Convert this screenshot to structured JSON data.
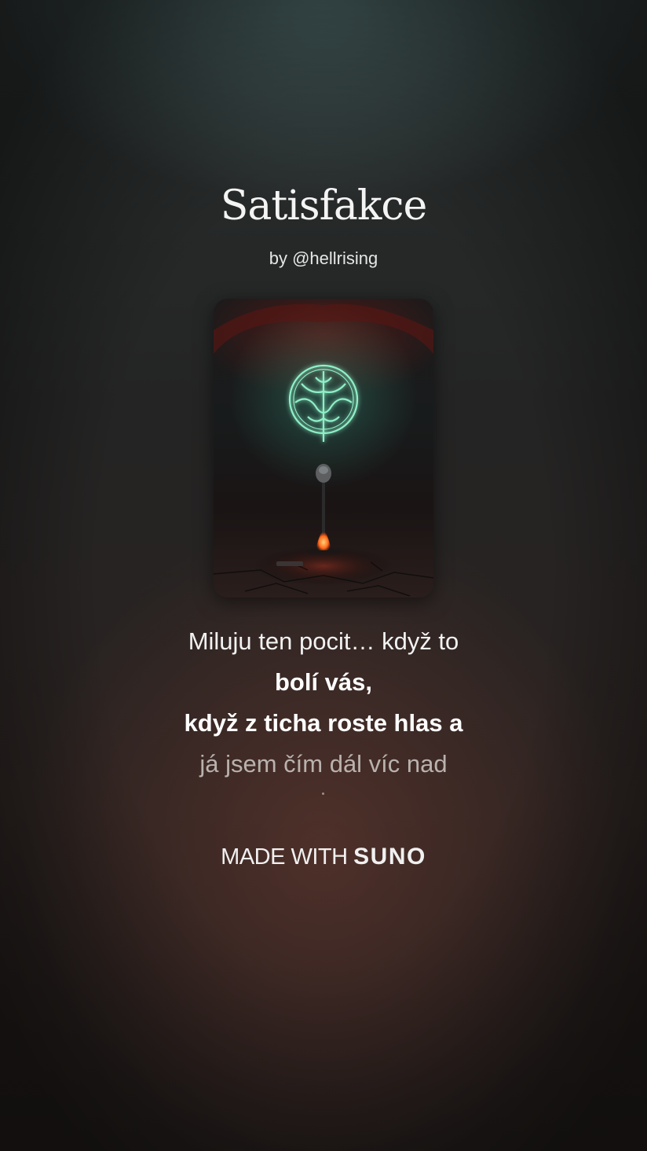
{
  "song": {
    "title": "Satisfakce",
    "byline": "by @hellrising"
  },
  "cover": {
    "icon": "glowing-sigil-microphone-artwork"
  },
  "lyrics": [
    "Miluju ten pocit… když to",
    "bolí vás,",
    "když z ticha roste hlas a",
    "já jsem čím dál víc nad"
  ],
  "footer": {
    "made_with": "MADE WITH",
    "brand": "SUNO"
  },
  "colors": {
    "accent_glow": "#6fe3b5",
    "text": "#ffffff"
  }
}
